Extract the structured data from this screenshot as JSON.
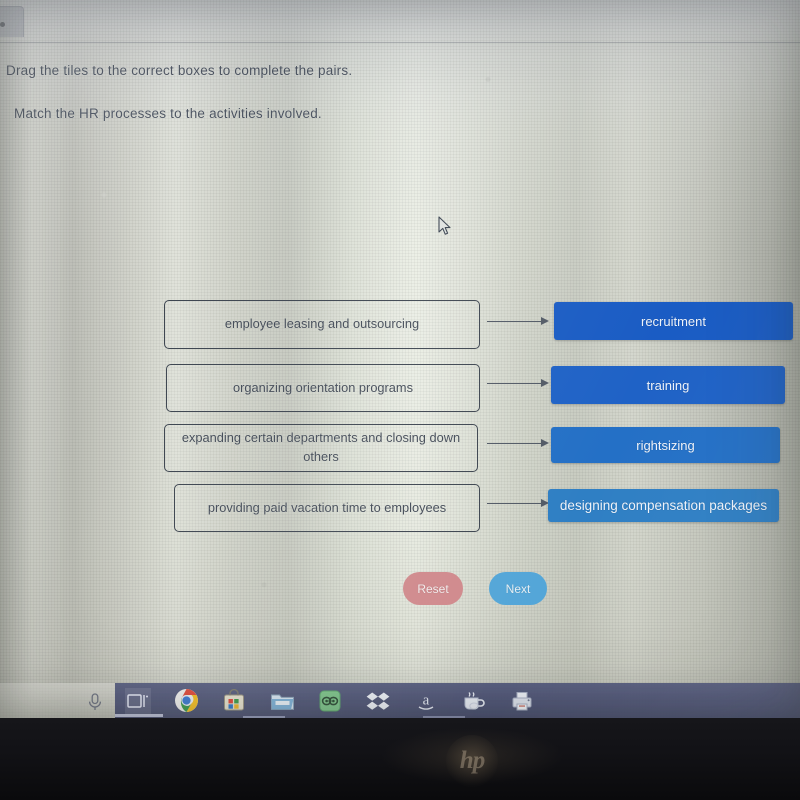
{
  "instructions": {
    "line1": "Drag the tiles to the correct boxes to complete the pairs.",
    "line2": "Match the HR processes to the activities involved."
  },
  "match_exercise": {
    "drop_boxes": [
      {
        "label": "employee leasing and outsourcing"
      },
      {
        "label": "organizing orientation programs"
      },
      {
        "label": "expanding certain departments and closing down others"
      },
      {
        "label": "providing paid vacation time to employees"
      }
    ],
    "tiles": [
      {
        "label": "recruitment",
        "color": "#1a5cc4"
      },
      {
        "label": "training",
        "color": "#1f62c6"
      },
      {
        "label": "rightsizing",
        "color": "#2470c6"
      },
      {
        "label": "designing compensation packages",
        "color": "#2f7fc4"
      }
    ],
    "arrow_count": 4
  },
  "actions": {
    "reset_label": "Reset",
    "reset_color": "#d08a8d",
    "next_label": "Next",
    "next_color": "#54a6d8"
  },
  "taskbar": {
    "items": [
      {
        "name": "cortana-mic-icon",
        "label": ""
      },
      {
        "name": "task-view-icon",
        "label": ""
      },
      {
        "name": "chrome-icon",
        "label": ""
      },
      {
        "name": "microsoft-store-icon",
        "label": ""
      },
      {
        "name": "file-explorer-icon",
        "label": ""
      },
      {
        "name": "green-app-icon",
        "label": ""
      },
      {
        "name": "dropbox-icon",
        "label": ""
      },
      {
        "name": "amazon-icon",
        "label": "a"
      },
      {
        "name": "java-icon",
        "label": ""
      },
      {
        "name": "printer-icon",
        "label": ""
      }
    ]
  },
  "device": {
    "brand": "hp"
  }
}
